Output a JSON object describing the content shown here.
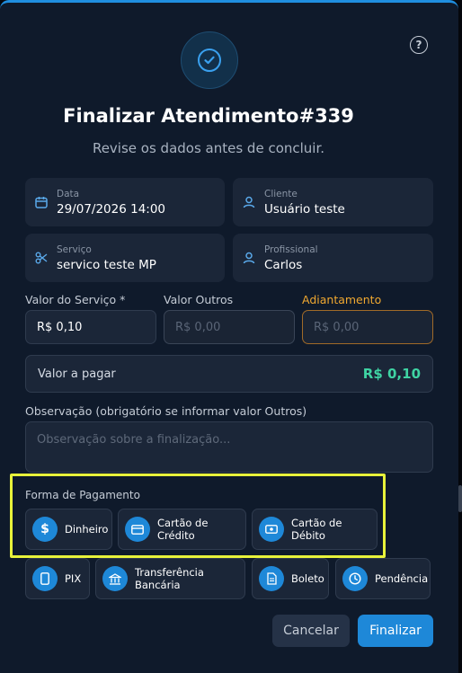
{
  "modal": {
    "title": "Finalizar Atendimento#339",
    "subtitle": "Revise os dados antes de concluir."
  },
  "info": {
    "date": {
      "label": "Data",
      "value": "29/07/2026 14:00",
      "icon": "calendar-icon"
    },
    "client": {
      "label": "Cliente",
      "value": "Usuário teste",
      "icon": "user-icon"
    },
    "service": {
      "label": "Serviço",
      "value": "servico teste MP",
      "icon": "scissors-icon"
    },
    "professional": {
      "label": "Profissional",
      "value": "Carlos",
      "icon": "user-icon"
    }
  },
  "fields": {
    "service_value": {
      "label": "Valor do Serviço *",
      "value": "R$ 0,10"
    },
    "other_value": {
      "label": "Valor Outros",
      "placeholder": "R$ 0,00"
    },
    "advance": {
      "label": "Adiantamento",
      "placeholder": "R$ 0,00"
    }
  },
  "amount_due": {
    "label": "Valor a pagar",
    "value": "R$ 0,10"
  },
  "note": {
    "label": "Observação (obrigatório se informar valor Outros)",
    "placeholder": "Observação sobre a finalização..."
  },
  "payment": {
    "label": "Forma de Pagamento",
    "methods": [
      {
        "label": "Dinheiro",
        "icon": "dollar-icon"
      },
      {
        "label": "Cartão de Crédito",
        "icon": "credit-card-icon"
      },
      {
        "label": "Cartão de Débito",
        "icon": "debit-card-icon"
      },
      {
        "label": "PIX",
        "icon": "phone-icon"
      },
      {
        "label": "Transferência Bancária",
        "icon": "bank-icon"
      },
      {
        "label": "Boleto",
        "icon": "document-icon"
      },
      {
        "label": "Pendência",
        "icon": "clock-icon"
      }
    ]
  },
  "actions": {
    "cancel": "Cancelar",
    "finish": "Finalizar"
  },
  "colors": {
    "accent": "#1e88d8",
    "success": "#3fd3a3",
    "warning": "#f0a830",
    "highlight": "#e8f23a"
  }
}
